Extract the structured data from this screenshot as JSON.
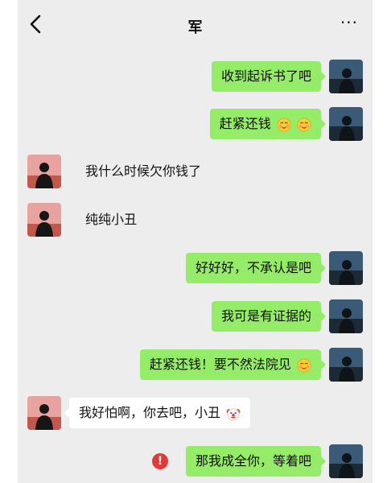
{
  "header": {
    "title": "军",
    "back_icon": "chevron-left-icon",
    "more_label": "···"
  },
  "colors": {
    "chat_background": "#ededed",
    "sent_bubble": "#95ec69",
    "received_bubble": "#ffffff",
    "error": "#e53935"
  },
  "messages": [
    {
      "side": "right",
      "text": "收到起诉书了吧",
      "emoji": []
    },
    {
      "side": "right",
      "text": "赶紧还钱",
      "emoji": [
        "blush-face",
        "blush-face"
      ]
    },
    {
      "side": "left",
      "text": "我什么时候欠你钱了",
      "emoji": []
    },
    {
      "side": "left",
      "text": "纯纯小丑",
      "emoji": []
    },
    {
      "side": "right",
      "text": "好好好，不承认是吧",
      "emoji": []
    },
    {
      "side": "right",
      "text": "我可是有证据的",
      "emoji": []
    },
    {
      "side": "right",
      "text": "赶紧还钱！要不然法院见",
      "emoji": [
        "blush-face"
      ]
    },
    {
      "side": "left",
      "text": "我好怕啊，你去吧，小丑",
      "emoji": [
        "clown-face"
      ]
    },
    {
      "side": "right",
      "text": "那我成全你，等着吧",
      "emoji": [],
      "status": "failed",
      "status_label": "!"
    }
  ]
}
